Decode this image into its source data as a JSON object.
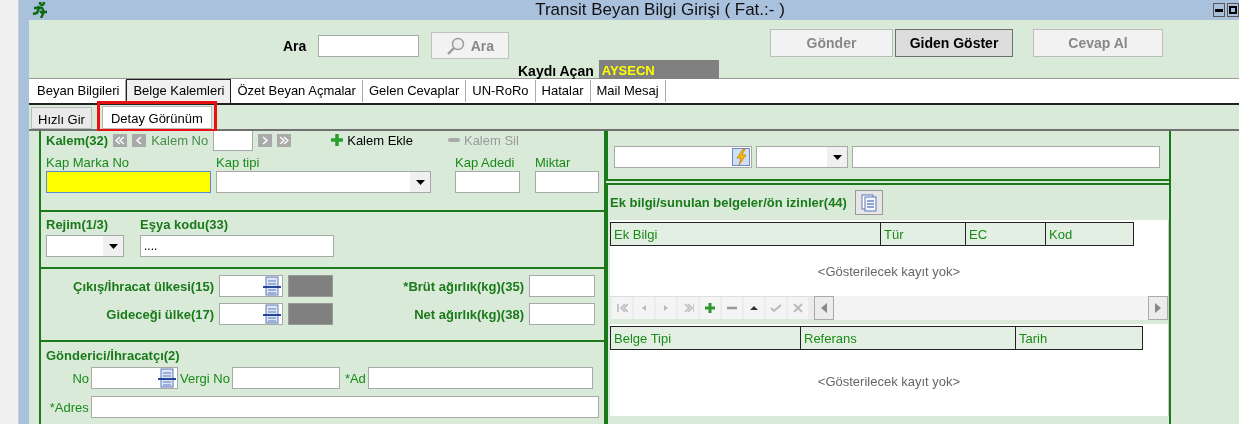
{
  "window": {
    "title": "Transit Beyan Bilgi Girişi ( Fat.:- )"
  },
  "search": {
    "label": "Ara",
    "button": "Ara"
  },
  "actions": [
    {
      "label": "Gönder",
      "disabled": true
    },
    {
      "label": "Giden Göster",
      "disabled": false
    },
    {
      "label": "Cevap Al",
      "disabled": true
    }
  ],
  "opened_by": {
    "label": "Kaydı Açan",
    "value": "AYSECN"
  },
  "tabs": [
    {
      "label": "Beyan Bilgileri",
      "selected": false
    },
    {
      "label": "Belge Kalemleri",
      "selected": true
    },
    {
      "label": "Özet Beyan Açmalar",
      "selected": false
    },
    {
      "label": "Gelen Cevaplar",
      "selected": false
    },
    {
      "label": "UN-RoRo",
      "selected": false
    },
    {
      "label": "Hatalar",
      "selected": false
    },
    {
      "label": "Mail Mesaj",
      "selected": false
    }
  ],
  "sub_tabs": [
    {
      "label": "Hızlı Gir",
      "selected": false,
      "highlighted": false
    },
    {
      "label": "Detay Görünüm",
      "selected": true,
      "highlighted": true
    }
  ],
  "item": {
    "title": "Kalem(32)",
    "number_label": "Kalem No",
    "actions": [
      {
        "label": "Kalem Ekle",
        "kind": "add",
        "disabled": false
      },
      {
        "label": "Kalem Sil",
        "kind": "remove",
        "disabled": true
      }
    ],
    "fields": [
      {
        "label": "Kap Marka No",
        "kind": "text",
        "focused": true
      },
      {
        "label": "Kap tipi",
        "kind": "select",
        "focused": false
      },
      {
        "label": "Kap Adedi",
        "kind": "text",
        "focused": false
      },
      {
        "label": "Miktar",
        "kind": "text",
        "focused": false
      }
    ]
  },
  "regime": {
    "label": "Rejim(1/3)"
  },
  "goods_code": {
    "label": "Eşya kodu(33)",
    "value": "...."
  },
  "countries": [
    {
      "label": "Çıkış/İhracat ülkesi(15)"
    },
    {
      "label": "Gideceği ülke(17)"
    }
  ],
  "weights": [
    {
      "label": "*Brüt ağırlık(kg)(35)"
    },
    {
      "label": "Net ağırlık(kg)(38)"
    }
  ],
  "consignor": {
    "title": "Gönderici/İhracatçı(2)",
    "no_label": "No",
    "tax_label": "Vergi No",
    "name_label": "*Ad",
    "address_label": "*Adres"
  },
  "documents": {
    "title": "Ek bilgi/sunulan belgeler/ön izinler(44)",
    "grids": [
      {
        "columns": [
          "Ek Bilgi",
          "Tür",
          "EC",
          "Kod"
        ],
        "empty_text": "<Gösterilecek kayıt yok>"
      },
      {
        "columns": [
          "Belge Tipi",
          "Referans",
          "Tarih"
        ],
        "empty_text": "<Gösterilecek kayıt yok>"
      }
    ]
  }
}
